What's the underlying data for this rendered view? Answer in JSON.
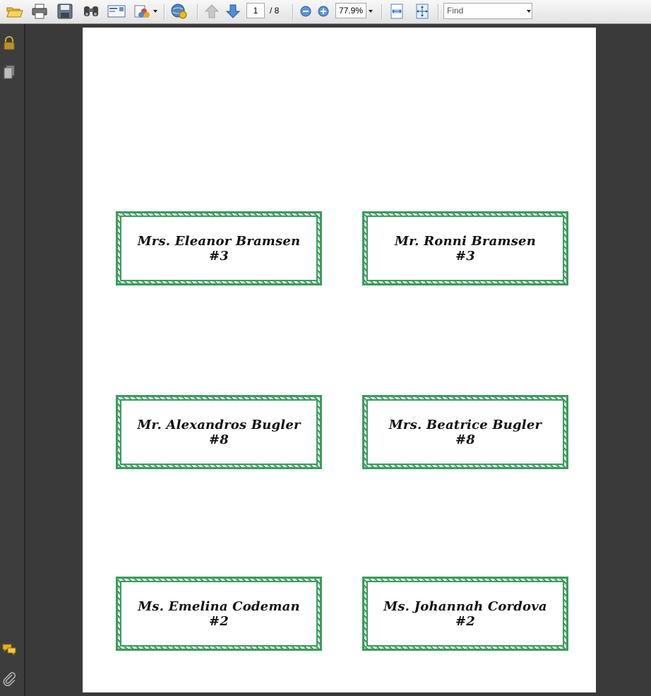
{
  "toolbar": {
    "page_current": "1",
    "page_total": "/ 8",
    "zoom_value": "77.9%",
    "find_placeholder": "Find",
    "icons": [
      "open-folder-icon",
      "print-icon",
      "save-icon",
      "find-binoculars-icon",
      "email-icon",
      "collaborate-icon",
      "web-capture-icon",
      "previous-page-icon",
      "next-page-icon",
      "zoom-out-icon",
      "zoom-in-icon",
      "fit-width-icon",
      "full-screen-icon"
    ]
  },
  "leftnav": {
    "icons": [
      "lock-icon",
      "pages-icon",
      "comments-icon",
      "attachments-icon"
    ]
  },
  "colors": {
    "card_border": "#3e9a5f",
    "card_pattern_light": "#bfe6c9",
    "toolbar_bg": "#e9e9e9",
    "viewer_bg": "#3a3a3a"
  },
  "cards": [
    {
      "name": "Mrs. Eleanor Bramsen",
      "table": "#3"
    },
    {
      "name": "Mr. Ronni Bramsen",
      "table": "#3"
    },
    {
      "name": "Mr. Alexandros Bugler",
      "table": "#8"
    },
    {
      "name": "Mrs. Beatrice Bugler",
      "table": "#8"
    },
    {
      "name": "Ms. Emelina Codeman",
      "table": "#2"
    },
    {
      "name": "Ms. Johannah Cordova",
      "table": "#2"
    }
  ]
}
